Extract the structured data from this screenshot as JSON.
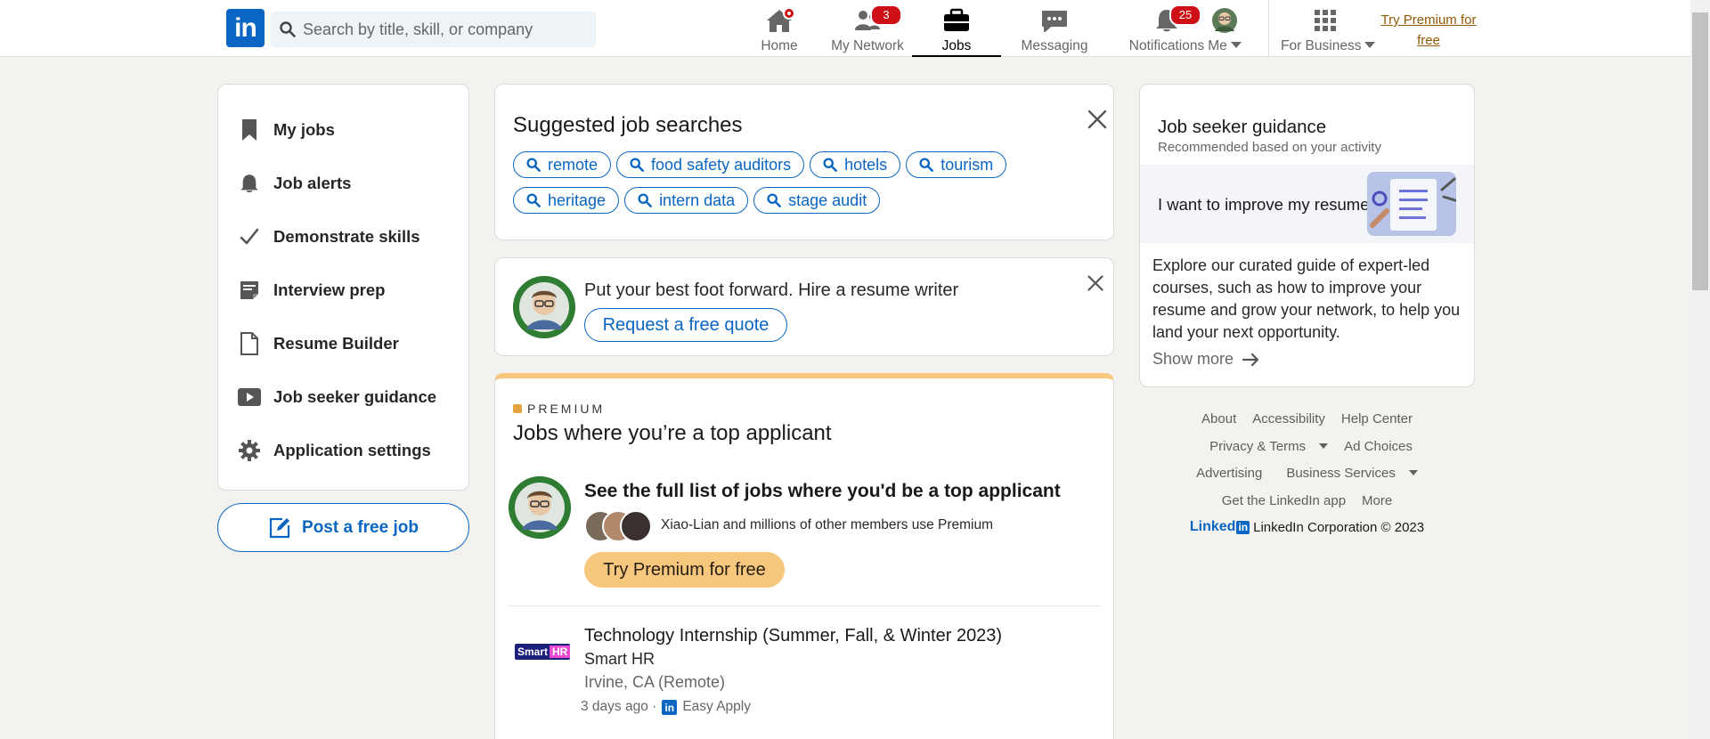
{
  "nav": {
    "logo": "in",
    "search_placeholder": "Search by title, skill, or company",
    "items": [
      {
        "label": "Home",
        "icon": "home-icon",
        "badge": ""
      },
      {
        "label": "My Network",
        "icon": "network-icon",
        "badge": "3"
      },
      {
        "label": "Jobs",
        "icon": "briefcase-icon",
        "badge": "",
        "active": true
      },
      {
        "label": "Messaging",
        "icon": "messaging-icon",
        "badge": ""
      },
      {
        "label": "Notifications",
        "icon": "bell-icon",
        "badge": "25"
      },
      {
        "label": "Me",
        "icon": "avatar",
        "badge": ""
      },
      {
        "label": "For Business",
        "icon": "grid-icon",
        "badge": ""
      }
    ],
    "premium_line1": "Try Premium for",
    "premium_line2": "free"
  },
  "sidebar": {
    "items": [
      {
        "label": "My jobs",
        "icon": "bookmark-icon"
      },
      {
        "label": "Job alerts",
        "icon": "bell-icon"
      },
      {
        "label": "Demonstrate skills",
        "icon": "checkmark-icon"
      },
      {
        "label": "Interview prep",
        "icon": "notepad-icon"
      },
      {
        "label": "Resume Builder",
        "icon": "document-icon"
      },
      {
        "label": "Job seeker guidance",
        "icon": "video-icon"
      },
      {
        "label": "Application settings",
        "icon": "gear-icon"
      }
    ],
    "post_job": "Post a free job"
  },
  "suggested": {
    "title": "Suggested job searches",
    "chips": [
      "remote",
      "food safety auditors",
      "hotels",
      "tourism",
      "heritage",
      "intern data",
      "stage audit"
    ]
  },
  "writer_promo": {
    "text": "Put your best foot forward. Hire a resume writer",
    "button": "Request a free quote"
  },
  "premium": {
    "tag": "PREMIUM",
    "title": "Jobs where you’re a top applicant",
    "row_title": "See the full list of jobs where you'd be a top applicant",
    "members_text": "Xiao-Lian and millions of other members use Premium",
    "button": "Try Premium for free"
  },
  "job": {
    "title": "Technology Internship (Summer, Fall, & Winter 2023)",
    "company": "Smart HR",
    "logo_text_a": "Smart",
    "logo_text_b": "HR",
    "location": "Irvine, CA (Remote)",
    "posted": "3 days ago ·",
    "apply": "Easy Apply"
  },
  "guidance": {
    "title": "Job seeker guidance",
    "subtitle": "Recommended based on your activity",
    "band_title": "I want to improve my resume",
    "description": "Explore our curated guide of expert-led courses, such as how to improve your resume and grow your network, to help you land your next opportunity.",
    "show_more": "Show more"
  },
  "footer": {
    "links_row1": [
      "About",
      "Accessibility",
      "Help Center"
    ],
    "links_row2": [
      "Privacy & Terms",
      "Ad Choices"
    ],
    "links_row3": [
      "Advertising",
      "Business Services"
    ],
    "links_row4": [
      "Get the LinkedIn app",
      "More"
    ],
    "brand": "Linked",
    "brand_in": "in",
    "copyright": "LinkedIn Corporation © 2023"
  },
  "colors": {
    "accent": "#0a66c2",
    "premium": "#f8c77e",
    "badge": "#cc1016"
  }
}
